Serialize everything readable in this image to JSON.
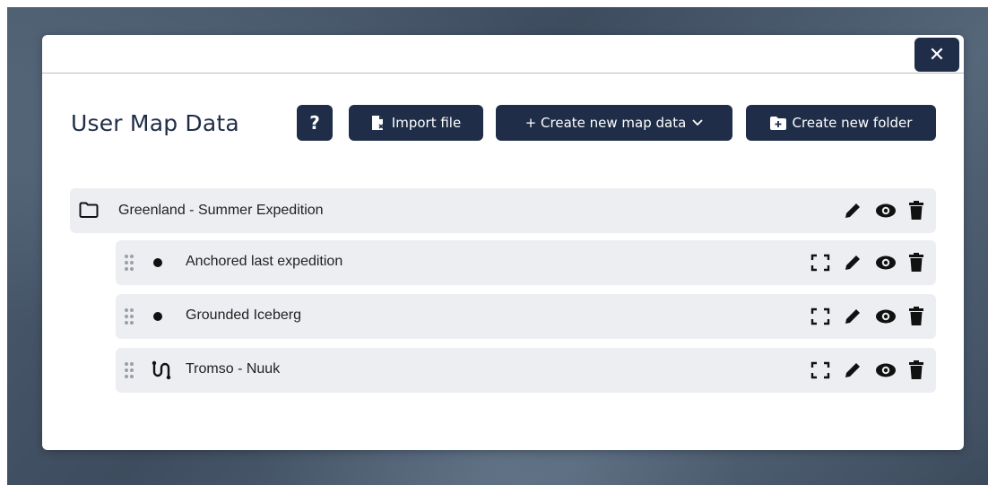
{
  "modal": {
    "close_label": "✕",
    "title": "User Map Data"
  },
  "toolbar": {
    "help_label": "?",
    "import_label": "Import file",
    "create_label": "+ Create new map data",
    "folder_label": "Create new folder"
  },
  "folder": {
    "name": "Greenland - Summer Expedition",
    "icon": "folder-icon",
    "actions": [
      "pencil-icon",
      "eye-icon",
      "trash-icon"
    ]
  },
  "items": [
    {
      "name": "Anchored last expedition",
      "type": "point",
      "icon": "dot-icon",
      "actions": [
        "expand-icon",
        "pencil-icon",
        "eye-icon",
        "trash-icon"
      ]
    },
    {
      "name": "Grounded Iceberg",
      "type": "point",
      "icon": "dot-icon",
      "actions": [
        "expand-icon",
        "pencil-icon",
        "eye-icon",
        "trash-icon"
      ]
    },
    {
      "name": "Tromso - Nuuk",
      "type": "route",
      "icon": "route-icon",
      "actions": [
        "expand-icon",
        "pencil-icon",
        "eye-icon",
        "trash-icon"
      ]
    }
  ],
  "colors": {
    "primary": "#1f2d48",
    "row_bg": "#eceef1",
    "text": "#222222"
  }
}
